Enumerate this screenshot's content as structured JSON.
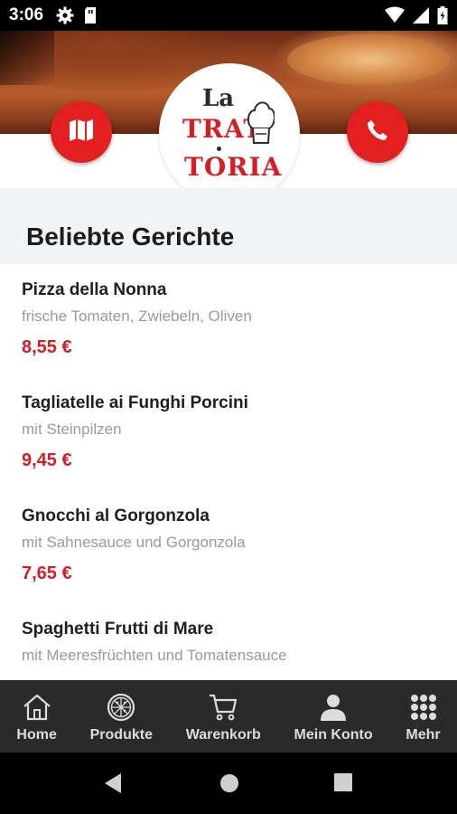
{
  "status_bar": {
    "time": "3:06",
    "icons": [
      "settings-icon",
      "sim-card-icon",
      "wifi-icon",
      "signal-icon",
      "battery-icon"
    ]
  },
  "header": {
    "logo": {
      "line1": "La",
      "line2": "TRAT",
      "line3": "TORIA"
    },
    "map_button_icon": "map-icon",
    "phone_button_icon": "phone-icon",
    "accent_color": "#e3201f"
  },
  "section": {
    "title": "Beliebte Gerichte"
  },
  "dishes": [
    {
      "name": "Pizza della Nonna",
      "description": "frische Tomaten, Zwiebeln, Oliven",
      "price": "8,55 €"
    },
    {
      "name": "Tagliatelle ai Funghi Porcini",
      "description": "mit Steinpilzen",
      "price": "9,45 €"
    },
    {
      "name": "Gnocchi al Gorgonzola",
      "description": "mit Sahnesauce und Gorgonzola",
      "price": "7,65 €"
    },
    {
      "name": "Spaghetti Frutti di Mare",
      "description": "mit Meeresfrüchten und Tomatensauce",
      "price": ""
    }
  ],
  "bottom_nav": {
    "items": [
      {
        "label": "Home",
        "icon": "home-icon"
      },
      {
        "label": "Produkte",
        "icon": "pizza-icon"
      },
      {
        "label": "Warenkorb",
        "icon": "cart-icon"
      },
      {
        "label": "Mein Konto",
        "icon": "user-icon"
      },
      {
        "label": "Mehr",
        "icon": "grid-icon"
      }
    ]
  },
  "system_nav": {
    "icons": [
      "back-icon",
      "home-circle-icon",
      "recents-icon"
    ]
  }
}
